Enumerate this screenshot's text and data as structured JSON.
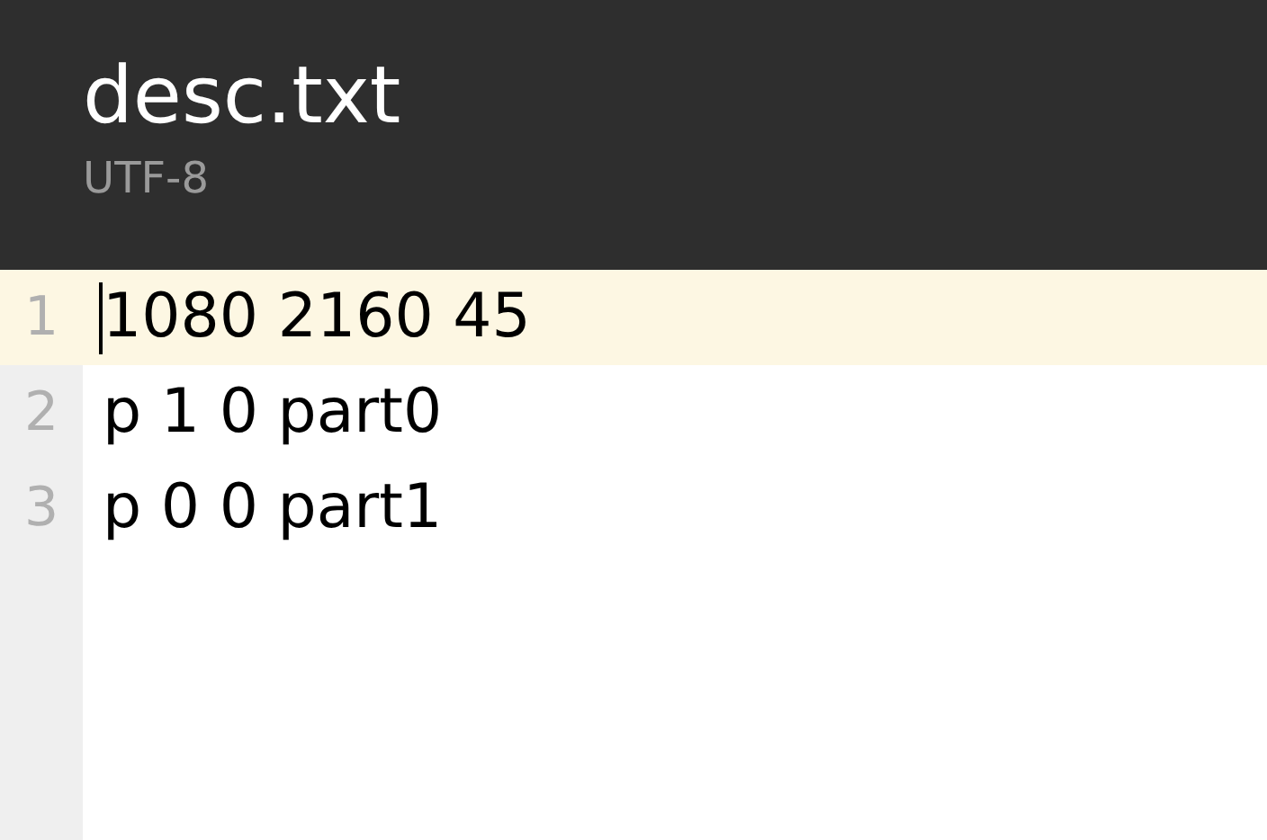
{
  "header": {
    "title": "desc.txt",
    "encoding": "UTF-8"
  },
  "lines": [
    {
      "number": "1",
      "text": "1080 2160 45",
      "current": true
    },
    {
      "number": "2",
      "text": "p 1 0 part0",
      "current": false
    },
    {
      "number": "3",
      "text": "p 0 0 part1",
      "current": false
    }
  ]
}
